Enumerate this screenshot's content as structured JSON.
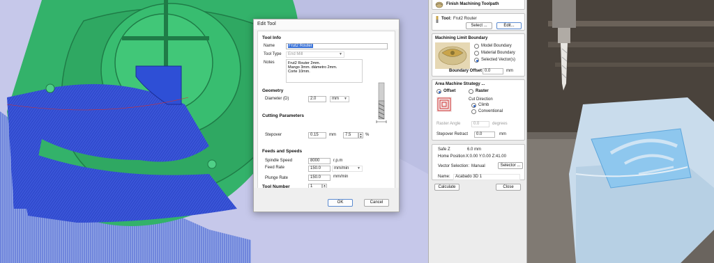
{
  "dialog": {
    "title": "Edit Tool",
    "tool_info": {
      "heading": "Tool Info",
      "name_label": "Name",
      "name_value": "Frut2 Router",
      "type_label": "Tool Type",
      "type_value": "End Mill",
      "notes_label": "Notes",
      "notes_lines": [
        "Frut2 Router 2mm.",
        "Mango 3mm. diámetro 2mm.",
        "Corte 10mm."
      ]
    },
    "geometry": {
      "heading": "Geometry",
      "diameter_label": "Diameter (D)",
      "diameter_value": "2.0",
      "unit": "mm"
    },
    "cutting": {
      "heading": "Cutting Parameters",
      "stepover_label": "Stepover",
      "stepover_mm": "0.15",
      "mm_unit": "mm",
      "stepover_pct": "7.5",
      "pct_unit": "%"
    },
    "feeds": {
      "heading": "Feeds and Speeds",
      "spindle_label": "Spindle Speed",
      "spindle_value": "8000",
      "spindle_unit": "r.p.m",
      "feed_label": "Feed Rate",
      "feed_value": "150.0",
      "feed_unit": "mm/min",
      "plunge_label": "Plunge Rate",
      "plunge_value": "150.0",
      "plunge_unit": "mm/min"
    },
    "tool_number": {
      "label": "Tool Number",
      "value": "1"
    },
    "ok_label": "OK",
    "cancel_label": "Cancel"
  },
  "toolpath": {
    "title": "Finish Machining Toolpath",
    "tool_label": "Tool:",
    "tool_name": "Frut2 Router",
    "select_label": "Select ...",
    "edit_label": "Edit...",
    "boundary": {
      "heading": "Machining Limit Boundary",
      "options": [
        "Model Boundary",
        "Material Boundary",
        "Selected Vector(s)"
      ],
      "selected": 2,
      "offset_label": "Boundary Offset",
      "offset_value": "0.0",
      "offset_unit": "mm"
    },
    "strategy": {
      "heading": "Area Machine Strategy ...",
      "offset_label": "Offset",
      "raster_label": "Raster",
      "cut_direction_label": "Cut Direction",
      "climb_label": "Climb",
      "conventional_label": "Conventional",
      "raster_angle_label": "Raster Angle",
      "raster_angle_value": "0.0",
      "raster_angle_unit": "degrees",
      "stepover_retract_label": "Stepover Retract",
      "stepover_retract_value": "0.0",
      "stepover_retract_unit": "mm"
    },
    "safe_z_label": "Safe Z",
    "safe_z_value": "6.0 mm",
    "home_label": "Home Position",
    "home_value": "X:0.00 Y:0.00 Z:41.00",
    "vector_selection_label": "Vector Selection:",
    "vector_selection_value": "Manual",
    "selector_label": "Selector ...",
    "name_label": "Name:",
    "name_value": "Acabado 3D 1",
    "calculate_label": "Calculate",
    "close_label": "Close"
  },
  "colors": {
    "model_green": "#33b26a",
    "toolpath_blue": "#2e4fd6",
    "accent": "#2b63c6",
    "foam_blue": "#8ec7ee"
  }
}
